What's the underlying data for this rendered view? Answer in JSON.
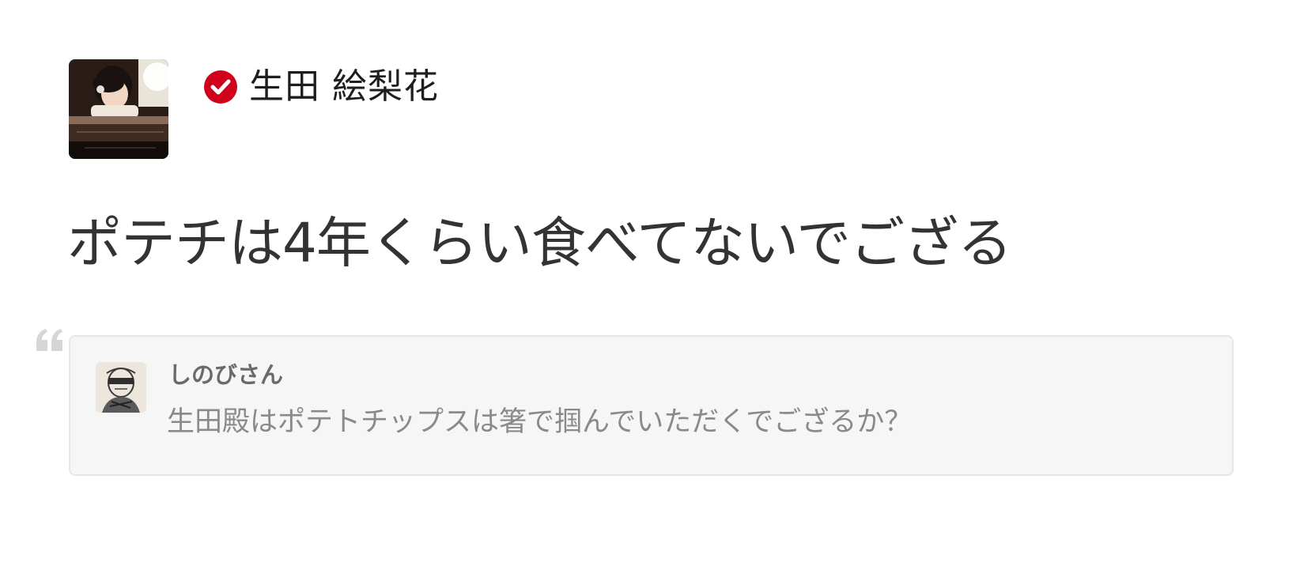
{
  "author": {
    "name": "生田 絵梨花",
    "verified": true,
    "avatar_icon": "author-photo",
    "verified_icon": "verified-check-icon",
    "accent_color": "#d0021b"
  },
  "answer": {
    "text": "ポテチは4年くらい食べてないでござる"
  },
  "question": {
    "quote_icon": "quote-mark-icon",
    "asker_name": "しのびさん",
    "asker_avatar_icon": "asker-avatar",
    "text": "生田殿はポテトチップスは箸で掴んでいただくでござるか？"
  }
}
